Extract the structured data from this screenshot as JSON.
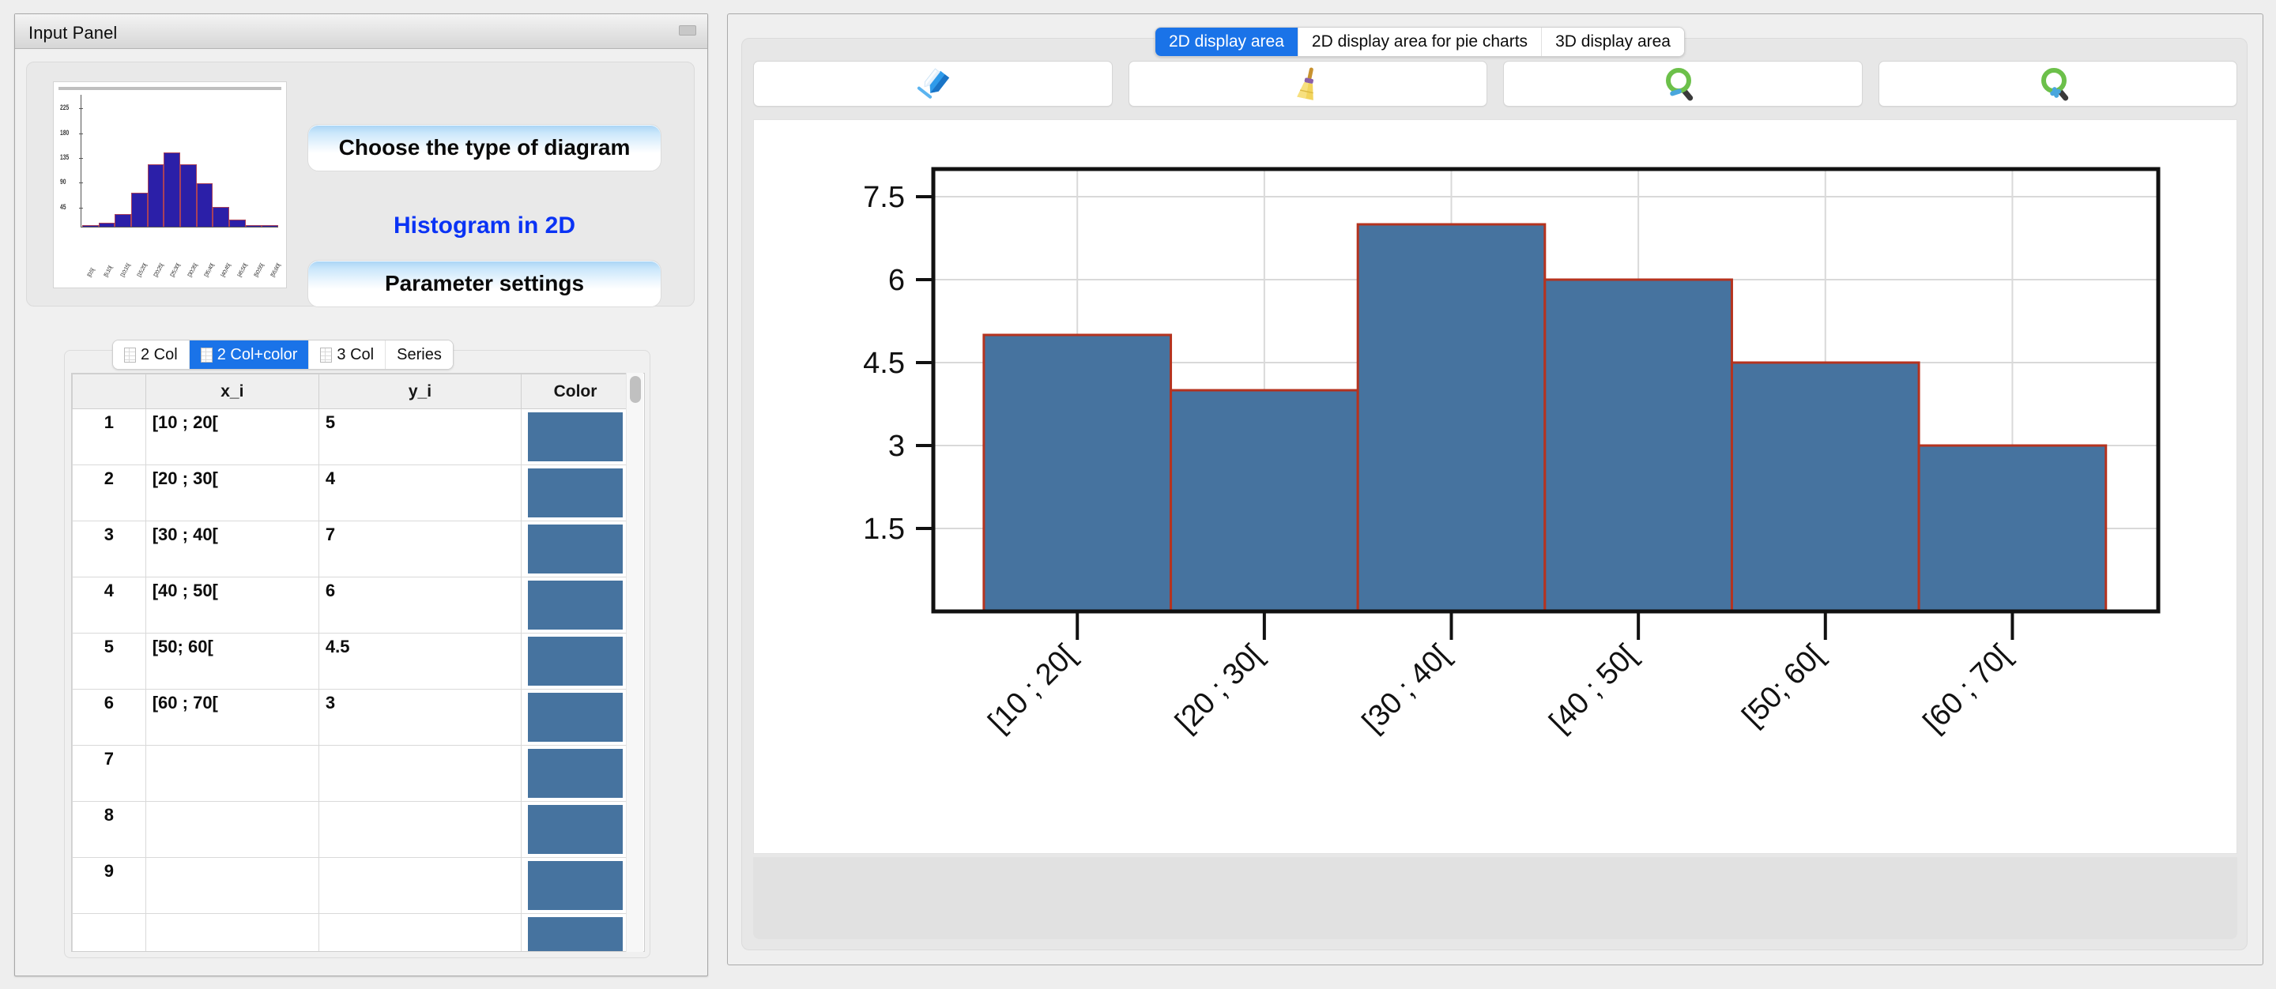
{
  "left_window": {
    "title": "Input Panel",
    "minimize_label": "",
    "chooser": {
      "choose_type_label": "Choose the type of diagram",
      "diagram_name": "Histogram in 2D",
      "parameter_settings_label": "Parameter settings",
      "thumbnail": {
        "y_ticks": [
          "225",
          "180",
          "135",
          "90",
          "45"
        ],
        "bar_values": [
          1,
          7,
          24,
          64,
          118,
          140,
          118,
          83,
          37,
          13,
          1,
          1
        ],
        "x_labels": [
          "[0;5[",
          "[5;10[",
          "[10;15[",
          "[15;20[",
          "[20;25[",
          "[25;30[",
          "[30;35[",
          "[35;40[",
          "[40;45[",
          "[45;50[",
          "[50;55[",
          "[55;60["
        ]
      }
    },
    "table": {
      "tabs": [
        {
          "label": "2 Col",
          "active": false,
          "icon": "sheet-icon"
        },
        {
          "label": "2 Col+color",
          "active": true,
          "icon": "sheet-icon"
        },
        {
          "label": "3 Col",
          "active": false,
          "icon": "sheet-icon"
        },
        {
          "label": "Series",
          "active": false,
          "icon": ""
        }
      ],
      "headers": [
        "",
        "x_i",
        "y_i",
        "Color"
      ],
      "rows": [
        {
          "n": "1",
          "x": "[10 ; 20[",
          "y": "5",
          "color": "#46739f"
        },
        {
          "n": "2",
          "x": "[20 ; 30[",
          "y": "4",
          "color": "#46739f"
        },
        {
          "n": "3",
          "x": "[30 ; 40[",
          "y": "7",
          "color": "#46739f"
        },
        {
          "n": "4",
          "x": "[40 ; 50[",
          "y": "6",
          "color": "#46739f"
        },
        {
          "n": "5",
          "x": "[50; 60[",
          "y": "4.5",
          "color": "#46739f"
        },
        {
          "n": "6",
          "x": "[60 ; 70[",
          "y": "3",
          "color": "#46739f"
        },
        {
          "n": "7",
          "x": "",
          "y": "",
          "color": "#46739f"
        },
        {
          "n": "8",
          "x": "",
          "y": "",
          "color": "#46739f"
        },
        {
          "n": "9",
          "x": "",
          "y": "",
          "color": "#46739f"
        },
        {
          "n": "",
          "x": "",
          "y": "",
          "color": "#46739f"
        }
      ]
    }
  },
  "right_window": {
    "tabs": [
      {
        "label": "2D display area",
        "active": true
      },
      {
        "label": "2D display area for pie charts",
        "active": false
      },
      {
        "label": "3D display area",
        "active": false
      }
    ],
    "toolbar": [
      {
        "name": "pen-icon",
        "title": "draw"
      },
      {
        "name": "broom-icon",
        "title": "clear"
      },
      {
        "name": "zoom-out-icon",
        "title": "zoom out"
      },
      {
        "name": "zoom-in-icon",
        "title": "zoom in"
      }
    ]
  },
  "chart_data": {
    "type": "bar",
    "title": "",
    "xlabel": "",
    "ylabel": "",
    "categories": [
      "[10 ; 20[",
      "[20 ; 30[",
      "[30 ; 40[",
      "[40 ; 50[",
      "[50; 60[",
      "[60 ; 70["
    ],
    "values": [
      5,
      4,
      7,
      6,
      4.5,
      3
    ],
    "yticks": [
      1.5,
      3,
      4.5,
      6,
      7.5
    ],
    "ytick_labels": [
      "1.5",
      "3",
      "4.5",
      "6",
      "7.5"
    ],
    "ylim": [
      0,
      8
    ],
    "grid": true,
    "legend": "none",
    "bar_fill": "#46739f",
    "bar_border": "#b5331f",
    "xtick_rotation": -45
  }
}
